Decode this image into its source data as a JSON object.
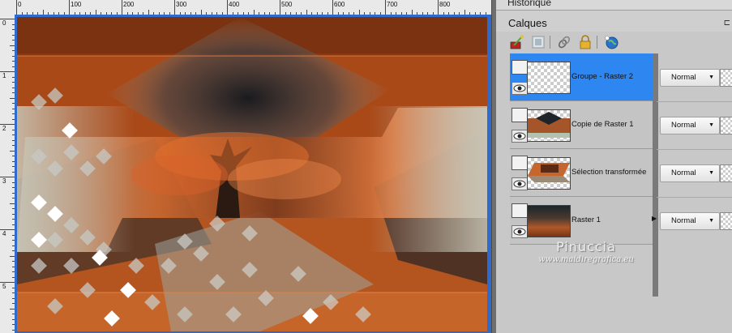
{
  "rulers": {
    "top_labels": [
      "0",
      "100",
      "200",
      "300",
      "400",
      "500",
      "600",
      "700",
      "800"
    ],
    "left_labels": [
      "0",
      "1",
      "2",
      "3",
      "4",
      "5"
    ]
  },
  "panel": {
    "historique_title": "Historique",
    "calques_title": "Calques",
    "toolbar_icons": [
      "paint-brush-icon",
      "mask-icon",
      "link-icon",
      "lock-icon",
      "globe-icon"
    ]
  },
  "layers": [
    {
      "name": "Groupe - Raster 2",
      "blend_mode": "Normal",
      "selected": true
    },
    {
      "name": "Copie de Raster 1",
      "blend_mode": "Normal",
      "selected": false
    },
    {
      "name": "Sélection transformée",
      "blend_mode": "Normal",
      "selected": false
    },
    {
      "name": "Raster 1",
      "blend_mode": "Normal",
      "selected": false
    }
  ],
  "watermark": {
    "name": "Pinuccia",
    "site": "www.maidiregrafica.eu"
  },
  "colors": {
    "selection": "#2e86f0",
    "canvas_border": "#2f6bcc",
    "rust": "#a8481a",
    "slate": "#2d3a44"
  }
}
